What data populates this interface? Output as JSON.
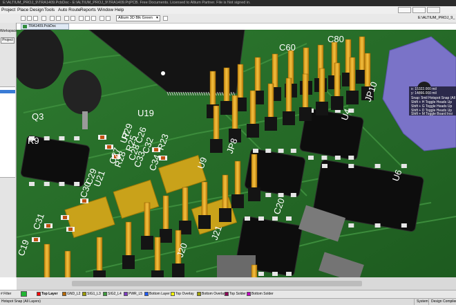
{
  "window": {
    "title": "E:\\ALTIUM_PROJ_9\\TRA1409.PcbDoc - E:\\ALTIUM_PROJ_9\\TRA1409.PrjPCB. Free Documents. Licensed to Altium Partner. File is Not signed in."
  },
  "menu": {
    "items": [
      "Project",
      "Place",
      "Design",
      "Tools",
      "Auto Route",
      "Reports",
      "Window",
      "Help"
    ]
  },
  "toolbar": {
    "view_config": "Altium 3D Blk Green",
    "path": "E:\\ALTIUM_PROJ_9_"
  },
  "left_panel": {
    "tab_workspace": "Workspace",
    "btn_project": "Project"
  },
  "document_tab": {
    "label": "TRA1409.PcbDoc"
  },
  "board_labels": [
    "Q3",
    "R9",
    "U19",
    "U7",
    "R23",
    "U9",
    "JP8",
    "U4",
    "JP10",
    "C60",
    "C80",
    "R29",
    "C32",
    "C33",
    "U21",
    "C31",
    "C30",
    "C29",
    "C34",
    "C19",
    "J20",
    "J21",
    "C20",
    "U6",
    "C27",
    "C28",
    "R28",
    "R25",
    "C26"
  ],
  "hud": {
    "x": "x: 15322.000 mil",
    "y": "y: 14866.000 mil",
    "snap": "Snap: 5mil  Hotspot Snap (All",
    "hint1": "Shift + H  Toggle Heads Up",
    "hint2": "Shift + G  Toggle Heads Up",
    "hint3": "Shift + D  Toggle Heads Up",
    "hint4": "Shift + M  Toggle Board Insi"
  },
  "layers": {
    "filter_label": "# Filter",
    "items": [
      {
        "name": "Top Layer",
        "color": "#ff0000"
      },
      {
        "name": "GND_L2",
        "color": "#b86a00"
      },
      {
        "name": "SIG1_L3",
        "color": "#9c9c00"
      },
      {
        "name": "SIG2_L4",
        "color": "#3c9c3c"
      },
      {
        "name": "PWR_L5",
        "color": "#7c3cc0"
      },
      {
        "name": "Bottom Layer",
        "color": "#1e5cff"
      },
      {
        "name": "Top Overlay",
        "color": "#ffff00"
      },
      {
        "name": "Bottom Overlay",
        "color": "#a0a000"
      },
      {
        "name": "Top Solder",
        "color": "#8b0055"
      },
      {
        "name": "Bottom Solder",
        "color": "#c000c0"
      }
    ]
  },
  "status": {
    "left": "Hotspot Snap (All Layers)",
    "system": "System",
    "design_compiler": "Design Compiler"
  }
}
